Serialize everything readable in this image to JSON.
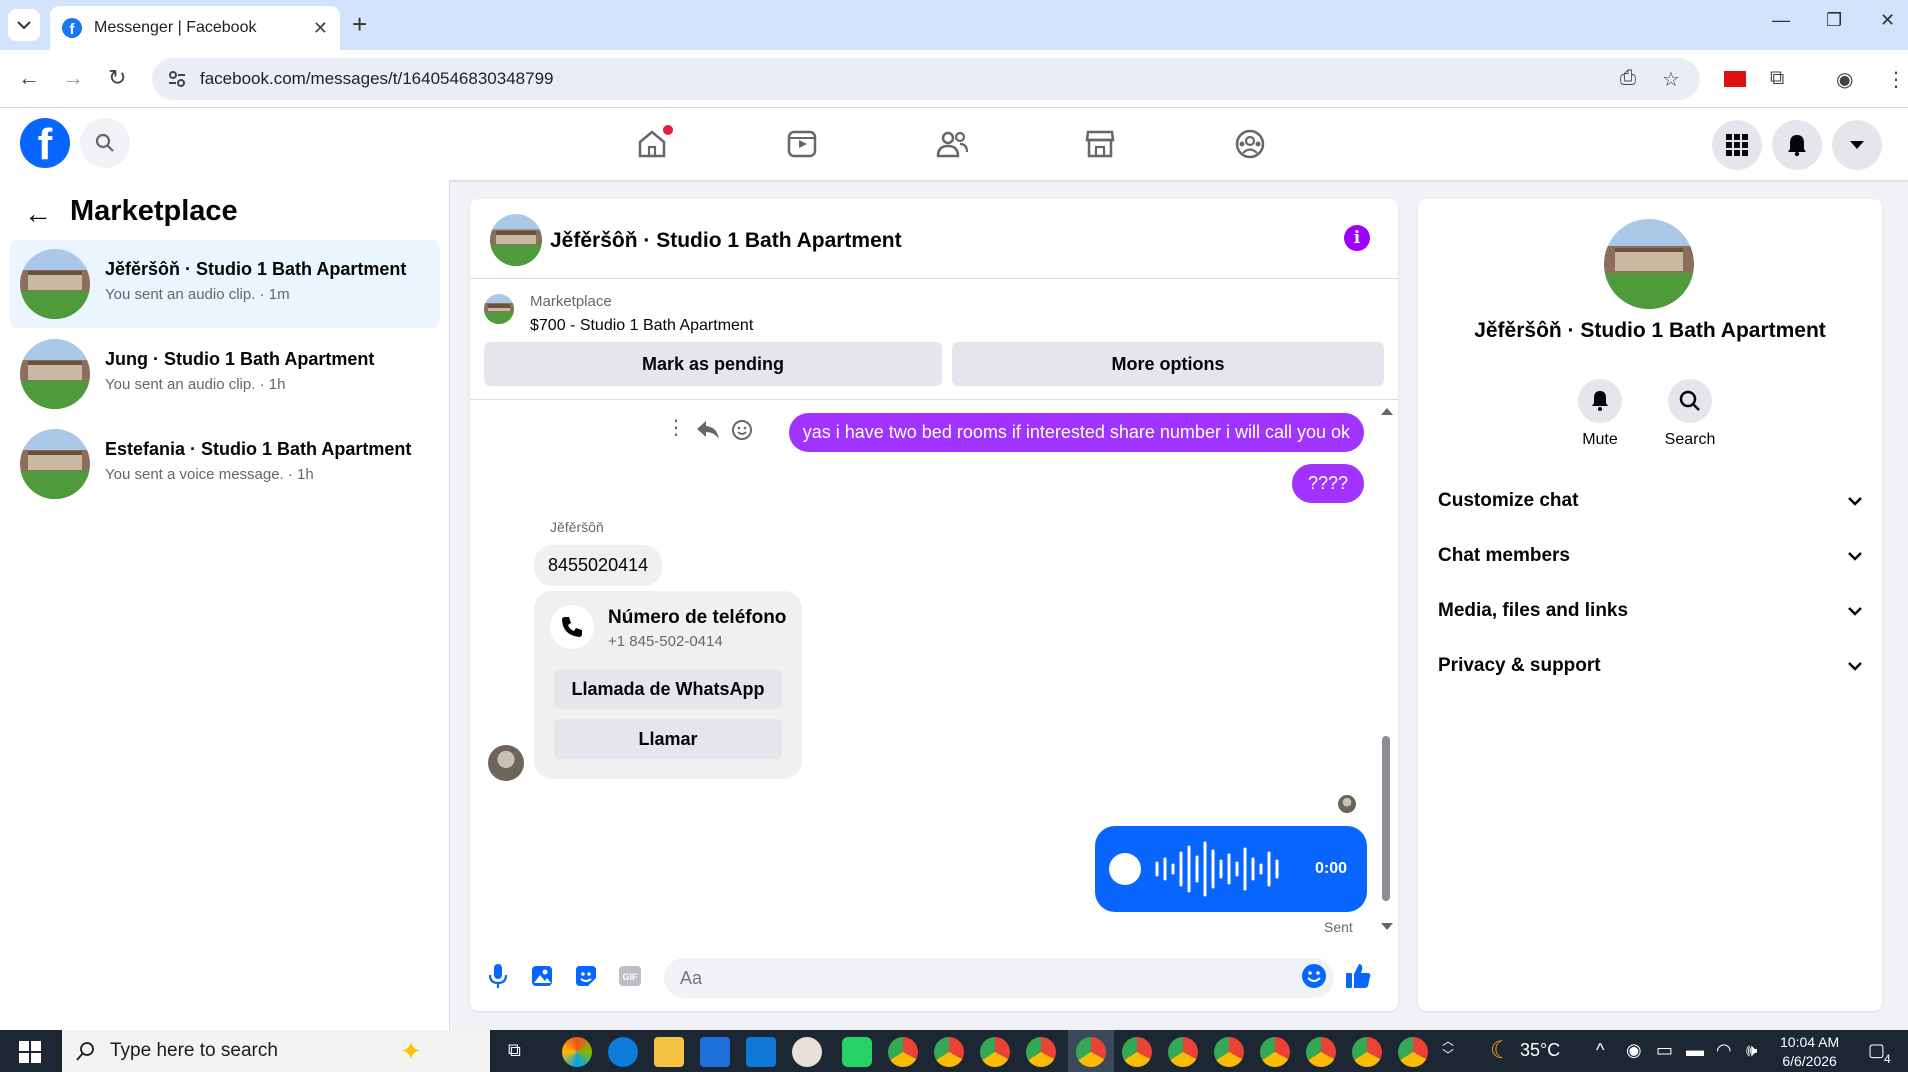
{
  "browser": {
    "tab_title": "Messenger | Facebook",
    "url": "facebook.com/messages/t/1640546830348799",
    "new_tab": "+",
    "tab_close": "✕"
  },
  "fb": {
    "logo": "f",
    "nav_icons": [
      "home-icon",
      "video-icon",
      "friends-icon",
      "marketplace-icon",
      "groups-icon"
    ]
  },
  "left": {
    "title": "Marketplace",
    "conversations": [
      {
        "name": "Jěfěršôň · Studio 1 Bath Apartment",
        "preview": "You sent an audio clip. · 1m",
        "active": true
      },
      {
        "name": "Jung · Studio 1 Bath Apartment",
        "preview": "You sent an audio clip. · 1h",
        "active": false
      },
      {
        "name": "Estefania · Studio 1 Bath Apartment",
        "preview": "You sent a voice message. · 1h",
        "active": false
      }
    ]
  },
  "chat": {
    "header_name": "Jěfěršôň · Studio 1 Bath Apartment",
    "info_glyph": "i",
    "listing_category": "Marketplace",
    "listing_title": "$700 - Studio 1 Bath Apartment",
    "mark_pending": "Mark as pending",
    "more_options": "More options",
    "messages": {
      "out1": "yas i have two bed rooms if interested share number i will call you ok",
      "out2": "????",
      "sender": "Jěfěršôň",
      "in1": "8455020414",
      "card_title": "Número de teléfono",
      "card_number": "+1 845-502-0414",
      "card_btn1": "Llamada de WhatsApp",
      "card_btn2": "Llamar",
      "audio_duration": "0:00",
      "sent_status": "Sent"
    },
    "composer_placeholder": "Aa"
  },
  "right": {
    "name": "Jěfěršôň · Studio 1 Bath Apartment",
    "mute": "Mute",
    "search": "Search",
    "rows": [
      "Customize chat",
      "Chat members",
      "Media, files and links",
      "Privacy & support"
    ]
  },
  "taskbar": {
    "search_placeholder": "Type here to search",
    "temperature": "35°C",
    "time": "10:04 AM",
    "date": "6/6/2026",
    "notif_count": "4"
  },
  "colors": {
    "accent_purple": "#a033ff",
    "messenger_blue": "#0866ff",
    "fb_blue": "#0866ff"
  }
}
